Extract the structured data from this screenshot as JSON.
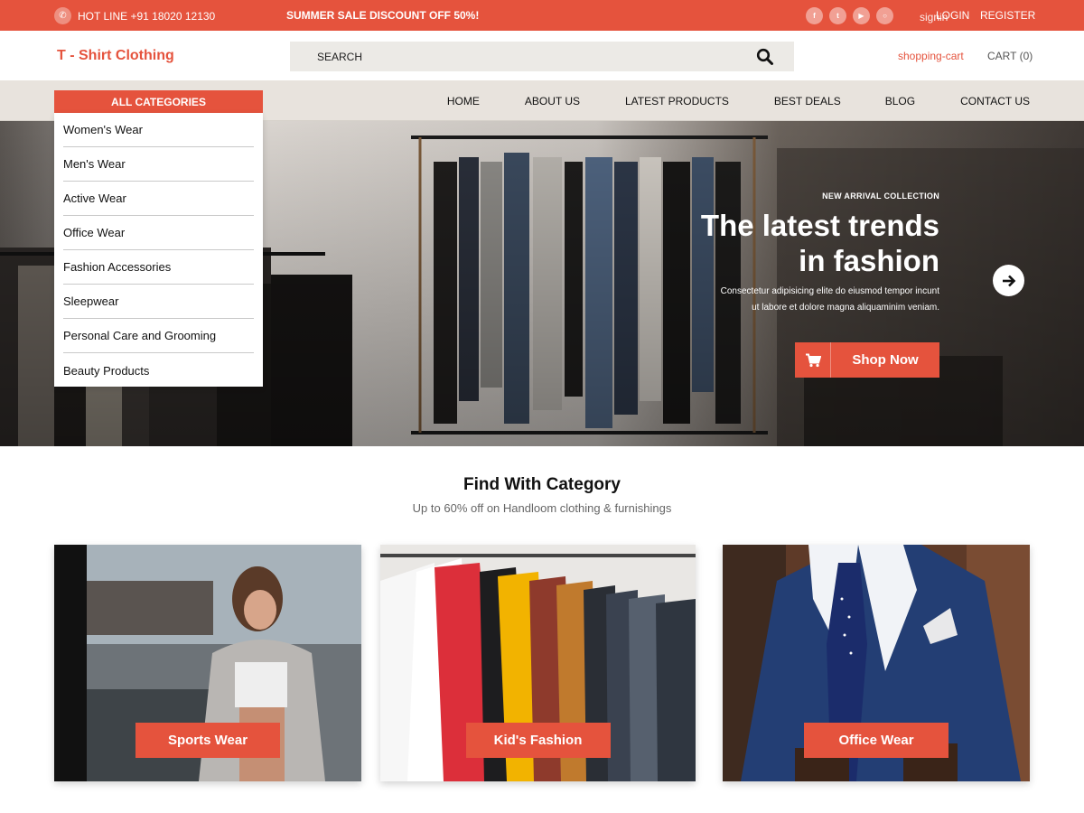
{
  "colors": {
    "accent": "#e5533d",
    "nav_bg": "#e8e3dd",
    "search_bg": "#eceae6"
  },
  "topbar": {
    "hotline": "HOT LINE +91 18020 12130",
    "sale": "SUMMER SALE DISCOUNT OFF 50%!",
    "socials": [
      "facebook-icon",
      "twitter-icon",
      "youtube-icon",
      "instagram-icon"
    ],
    "signin": "signin",
    "login": "LOGIN",
    "register": "REGISTER"
  },
  "header": {
    "brand": "T - Shirt Clothing",
    "search_placeholder": "SEARCH",
    "cart_icon_label": "shopping-cart",
    "cart": "CART (0)"
  },
  "nav": {
    "items": [
      "HOME",
      "ABOUT US",
      "LATEST PRODUCTS",
      "BEST DEALS",
      "BLOG",
      "CONTACT US"
    ]
  },
  "categories": {
    "heading": "ALL CATEGORIES",
    "items": [
      "Women's Wear",
      "Men's Wear",
      "Active Wear",
      "Office Wear",
      "Fashion Accessories",
      "Sleepwear",
      "Personal Care and Grooming",
      "Beauty Products"
    ]
  },
  "hero": {
    "kicker": "NEW ARRIVAL COLLECTION",
    "title_line1": "The latest trends",
    "title_line2": "in fashion",
    "subtitle_line1": "Consectetur adipisicing elite do eiusmod tempor incunt",
    "subtitle_line2": "ut labore et dolore magna aliquaminim veniam.",
    "button": "Shop Now"
  },
  "find": {
    "title": "Find With Category",
    "subtitle": "Up to 60% off on Handloom clothing & furnishings",
    "cards": [
      "Sports Wear",
      "Kid's Fashion",
      "Office Wear"
    ]
  }
}
